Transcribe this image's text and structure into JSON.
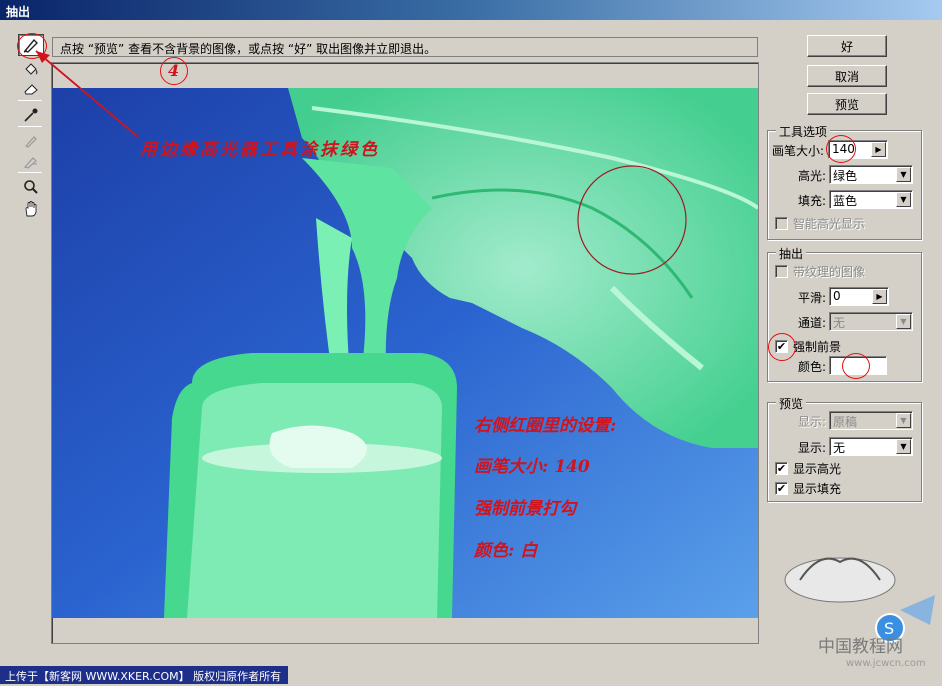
{
  "window": {
    "title": "抽出"
  },
  "hint": {
    "text": "点按 “预览” 查看不含背景的图像，或点按 “好” 取出图像并立即退出。"
  },
  "buttons": {
    "ok": "好",
    "cancel": "取消",
    "preview": "预览"
  },
  "tool_options": {
    "title": "工具选项",
    "brush_size_label": "画笔大小:",
    "brush_size_value": "140",
    "highlight_label": "高光:",
    "highlight_value": "绿色",
    "fill_label": "填充:",
    "fill_value": "蓝色",
    "smart_highlight_label": "智能高光显示",
    "smart_highlight_checked": false
  },
  "extraction": {
    "title": "抽出",
    "textured_label": "带纹理的图像",
    "smooth_label": "平滑:",
    "smooth_value": "0",
    "channel_label": "通道:",
    "channel_value": "无",
    "force_foreground_label": "强制前景",
    "force_foreground_checked": true,
    "color_label": "颜色:"
  },
  "preview_group": {
    "title": "预览",
    "show1_label": "显示:",
    "show1_value": "原稿",
    "show2_label": "显示:",
    "show2_value": "无",
    "show_highlight_label": "显示高光",
    "show_fill_label": "显示填充",
    "show_highlight_checked": true,
    "show_fill_checked": true
  },
  "annotations": {
    "step_number": "4",
    "highlighter_note": "用边缘高光器工具涂抹绿色",
    "settings_title": "右侧红圈里的设置:",
    "brush_note": "画笔大小: 140",
    "force_note": "强制前景打勾",
    "color_note": "颜色: 白"
  },
  "footer": {
    "text": "上传于【新客网 WWW.XKER.COM】 版权归原作者所有"
  },
  "watermark": {
    "site": "www.jcwcn.com",
    "brand": "中国教程网"
  },
  "icons": [
    "edge-highlighter-icon",
    "fill-bucket-icon",
    "eraser-icon",
    "eyedropper-icon",
    "cleanup-tool-icon",
    "edge-touchup-icon",
    "zoom-icon",
    "hand-icon"
  ],
  "colors": {
    "highlight_green": "#3fe08a",
    "background_blue": "#1f4fbf",
    "annotation_red": "#d0141e",
    "title_bar": "#0a246a"
  }
}
